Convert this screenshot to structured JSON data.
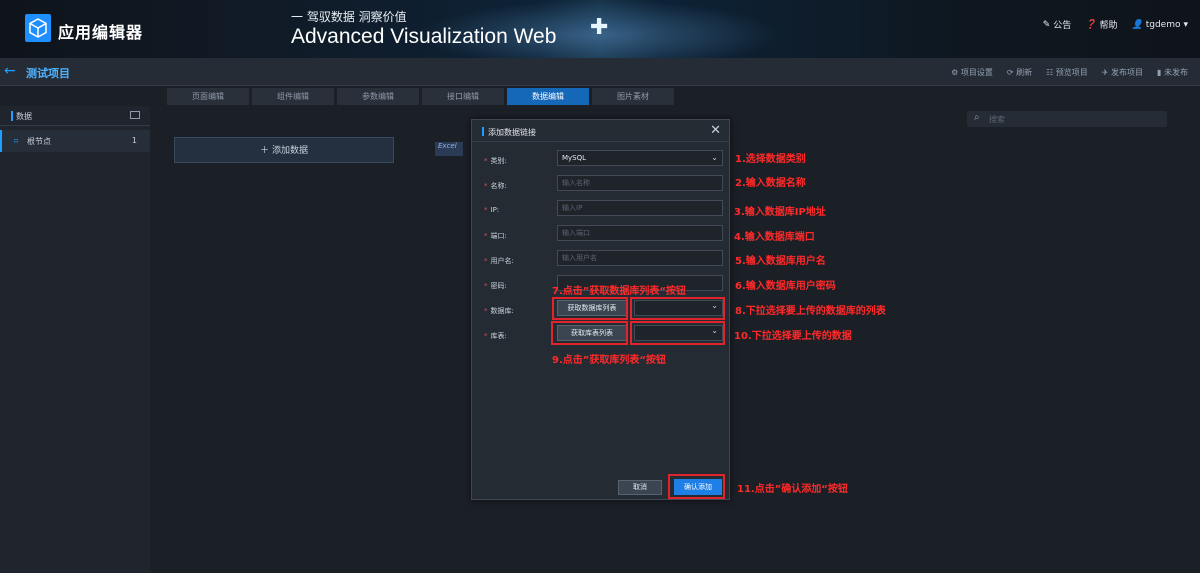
{
  "header": {
    "app_name": "应用编辑器",
    "slogan_cn": "一 驾驭数据 洞察价值",
    "slogan_en": "Advanced Visualization Web",
    "links": [
      {
        "icon": "announcement-icon",
        "label": "公告"
      },
      {
        "icon": "help-icon",
        "label": "帮助"
      },
      {
        "icon": "user-icon",
        "label": "tgdemo"
      }
    ]
  },
  "project": {
    "title": "测试项目",
    "actions": [
      "项目设置",
      "刷新",
      "预览项目",
      "发布项目",
      "未发布"
    ]
  },
  "tabs": [
    "页面编辑",
    "组件编辑",
    "参数编辑",
    "接口编辑",
    "数据编辑",
    "图片素材"
  ],
  "active_tab": "数据编辑",
  "sidebar": {
    "title": "数据",
    "items": [
      {
        "label": "根节点",
        "count": "1"
      }
    ]
  },
  "main": {
    "add_data_label": "添加数据",
    "excel_tag": "Excel",
    "search_placeholder": "搜索"
  },
  "modal": {
    "title": "添加数据链接",
    "fields": {
      "type_label": "类别:",
      "type_value": "MySQL",
      "name_label": "名称:",
      "name_placeholder": "输入名称",
      "ip_label": "IP:",
      "ip_placeholder": "输入IP",
      "port_label": "端口:",
      "port_placeholder": "输入端口",
      "user_label": "用户名:",
      "user_placeholder": "输入用户名",
      "password_label": "密码:",
      "db_label": "数据库:",
      "db_button": "获取数据库列表",
      "table_label": "库表:",
      "table_button": "获取库表列表"
    },
    "cancel_label": "取消",
    "confirm_label": "确认添加"
  },
  "annotations": {
    "a1": "1.选择数据类别",
    "a2": "2.输入数据名称",
    "a3": "3.输入数据库IP地址",
    "a4": "4.输入数据库端口",
    "a5": "5.输入数据库用户名",
    "a6": "6.输入数据库用户密码",
    "a7": "7.点击”获取数据库列表“按钮",
    "a8": "8.下拉选择要上传的数据库的列表",
    "a9": "9.点击”获取库列表“按钮",
    "a10": "10.下拉选择要上传的数据",
    "a11": "11.点击”确认添加“按钮"
  }
}
